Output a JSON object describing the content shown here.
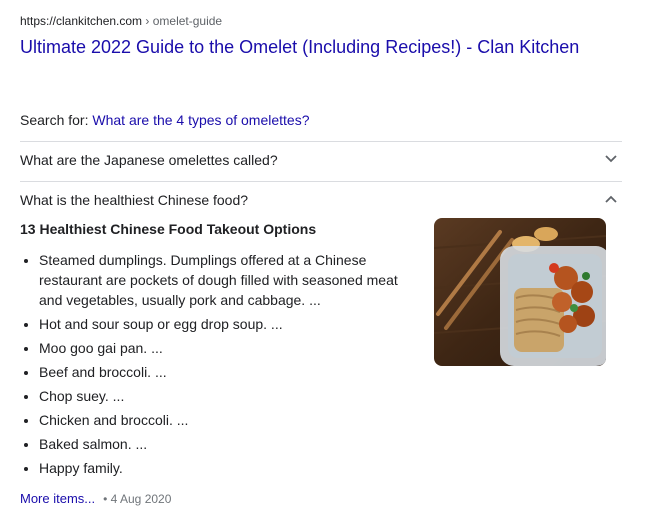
{
  "result": {
    "url_host": "https://clankitchen.com",
    "url_sep": " › ",
    "url_path": "omelet-guide",
    "title": "Ultimate 2022 Guide to the Omelet (Including Recipes!) - Clan Kitchen",
    "search_for_label": "Search for: ",
    "search_for_query": "What are the 4 types of omelettes?"
  },
  "questions": [
    {
      "text": "What are the Japanese omelettes called?",
      "expanded": false,
      "chevron": "chevron-down-icon"
    },
    {
      "text": "What is the healthiest Chinese food?",
      "expanded": true,
      "chevron": "chevron-up-icon"
    }
  ],
  "answer": {
    "title": "13 Healthiest Chinese Food Takeout Options",
    "items": [
      "Steamed dumplings. Dumplings offered at a Chinese restaurant are pockets of dough filled with seasoned meat and vegetables, usually pork and cabbage. ...",
      "Hot and sour soup or egg drop soup. ...",
      "Moo goo gai pan. ...",
      "Beef and broccoli. ...",
      "Chop suey. ...",
      "Chicken and broccoli. ...",
      "Baked salmon. ...",
      "Happy family."
    ],
    "more_label": "More items...",
    "date": "• 4 Aug 2020"
  },
  "colors": {
    "link": "#1a0dab",
    "text": "#202124",
    "muted": "#5f6368",
    "divider": "#dadce0"
  }
}
